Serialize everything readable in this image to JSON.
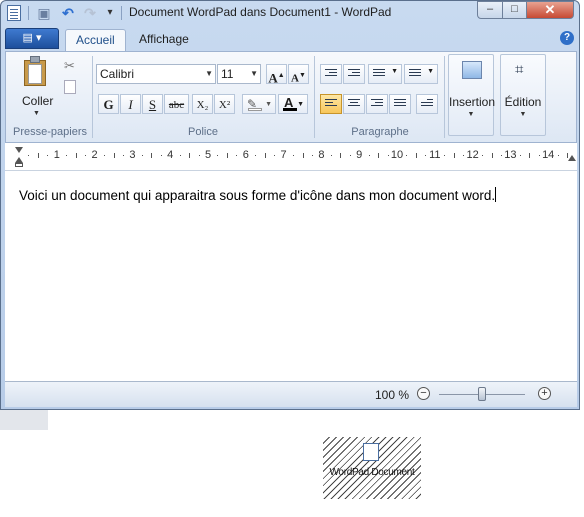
{
  "window": {
    "title": "Document WordPad dans Document1 - WordPad",
    "minimize_symbol": "–",
    "maximize_symbol": "□",
    "close_symbol": "✕"
  },
  "quick_access": [
    "save-icon",
    "undo-icon",
    "redo-icon",
    "customize-icon"
  ],
  "ribbon": {
    "file_menu_icon": "▤ ▾",
    "tabs": [
      {
        "label": "Accueil",
        "active": true
      },
      {
        "label": "Affichage",
        "active": false
      }
    ],
    "help_symbol": "?",
    "clipboard": {
      "paste_label": "Coller",
      "group_label": "Presse-papiers"
    },
    "font": {
      "family": "Calibri",
      "size": "11",
      "grow_label": "A",
      "shrink_label": "A",
      "bold_label": "G",
      "italic_label": "I",
      "underline_label": "S",
      "strike_label": "abc",
      "subscript_label": "X₂",
      "superscript_label": "X²",
      "color_label": "A",
      "group_label": "Police"
    },
    "paragraph": {
      "group_label": "Paragraphe"
    },
    "insert_label": "Insertion",
    "edit_label": "Édition"
  },
  "ruler": {
    "numbers": [
      "1",
      "2",
      "3",
      "4",
      "5",
      "6",
      "7",
      "8",
      "9",
      "10",
      "11",
      "12",
      "13",
      "14"
    ]
  },
  "document": {
    "text": "Voici un document qui apparaitra sous forme d'icône dans mon document word."
  },
  "status": {
    "zoom": "100 %",
    "zoom_out": "−",
    "zoom_in": "+",
    "zoom_level": 100
  },
  "embedded_object": {
    "label": "WordPad Document"
  },
  "colors": {
    "accent": "#2f6fc8",
    "active_button": "#f7c65a",
    "close_button": "#c74a34"
  }
}
